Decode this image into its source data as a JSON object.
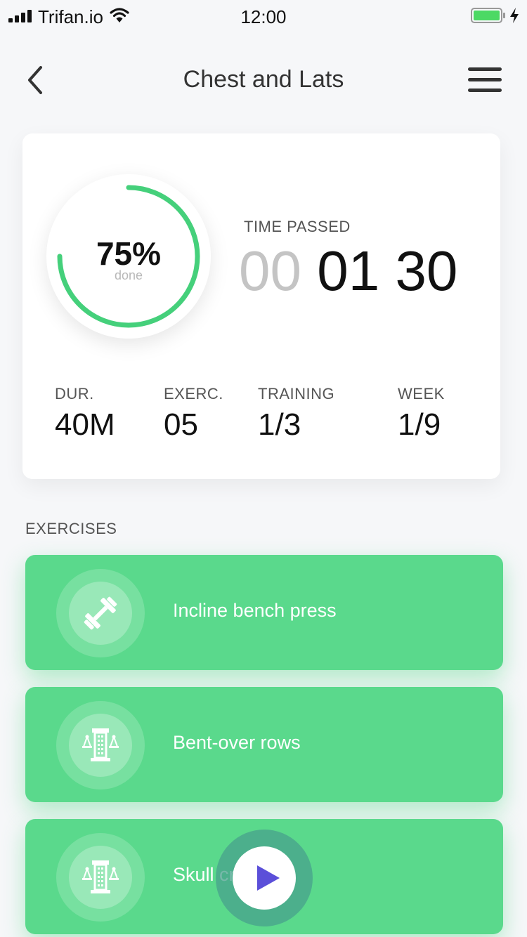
{
  "status_bar": {
    "carrier": "Trifan.io",
    "time": "12:00"
  },
  "nav": {
    "title": "Chest and Lats"
  },
  "summary": {
    "progress_fraction": 0.75,
    "progress_percent": "75%",
    "progress_caption": "done",
    "time_label": "TIME PASSED",
    "time_hours": "00",
    "time_minutes": "01",
    "time_seconds": "30",
    "stats": [
      {
        "label": "DUR.",
        "value": "40M"
      },
      {
        "label": "EXERC.",
        "value": "05"
      },
      {
        "label": "TRAINING",
        "value": "1/3"
      },
      {
        "label": "WEEK",
        "value": "1/9"
      }
    ]
  },
  "exercises": {
    "heading": "EXERCISES",
    "items": [
      {
        "name": "Incline bench press",
        "icon": "dumbbell-icon"
      },
      {
        "name": "Bent-over rows",
        "icon": "cable-machine-icon"
      },
      {
        "name": "Skull crushers",
        "icon": "cable-machine-icon"
      }
    ]
  },
  "colors": {
    "accent_green": "#5ad98c",
    "ring_green": "#45d07b",
    "play_purple": "#5b4fd9",
    "background": "#f6f7f9"
  }
}
